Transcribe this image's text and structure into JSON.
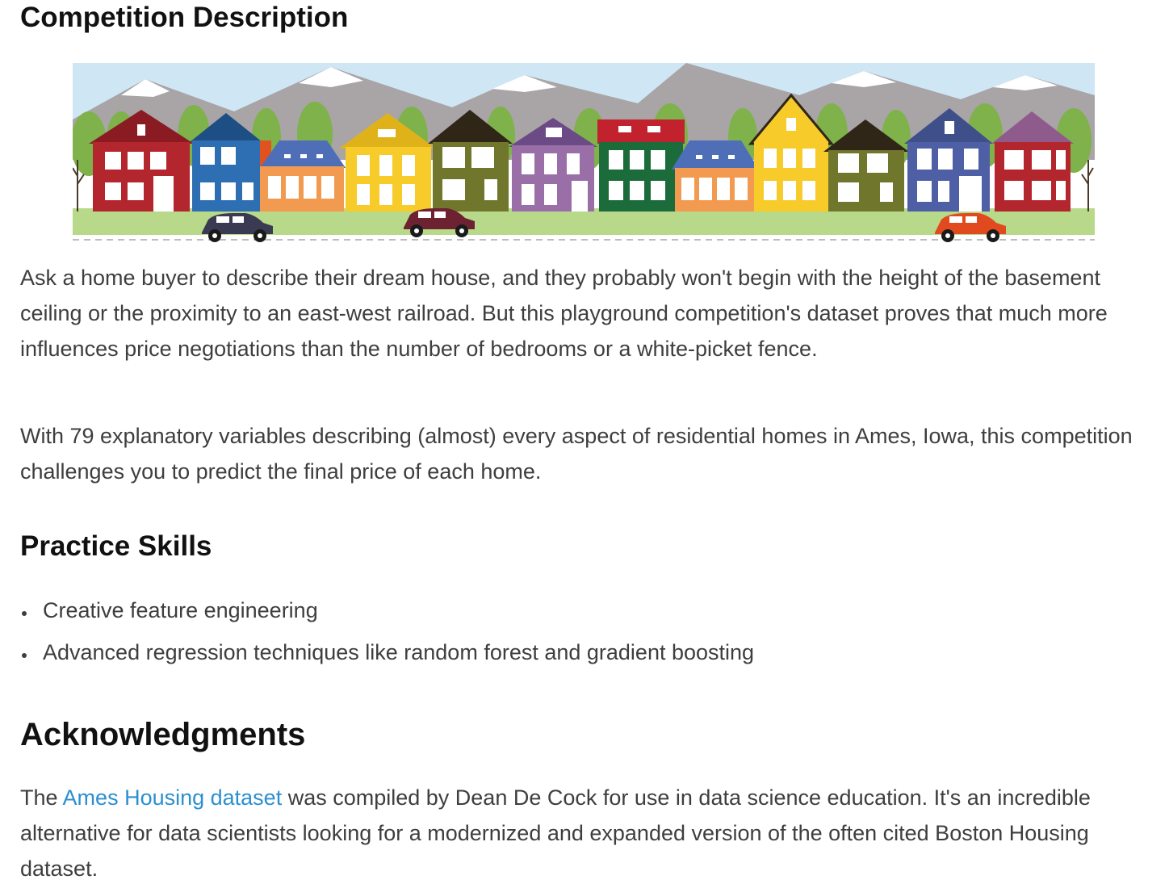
{
  "description": {
    "heading": "Competition Description",
    "banner_icon": "houses-street-illustration",
    "paragraph_1": "Ask a home buyer to describe their dream house, and they probably won't begin with the height of the basement ceiling or the proximity to an east-west railroad. But this playground competition's dataset proves that much more influences price negotiations than the number of bedrooms or a white-picket fence.",
    "paragraph_2": "With 79 explanatory variables describing (almost) every aspect of residential homes in Ames, Iowa, this competition challenges you to predict the final price of each home."
  },
  "practice": {
    "heading": "Practice Skills",
    "items": [
      "Creative feature engineering",
      "Advanced regression techniques like random forest and gradient boosting"
    ]
  },
  "acknowledgments": {
    "heading": "Acknowledgments",
    "text_before_link": "The ",
    "link_text": "Ames Housing dataset",
    "text_after_link": " was compiled by Dean De Cock for use in data science education. It's an incredible alternative for data scientists looking for a modernized and expanded version of the often cited Boston Housing dataset.",
    "link_color": "#2c8fd0"
  }
}
